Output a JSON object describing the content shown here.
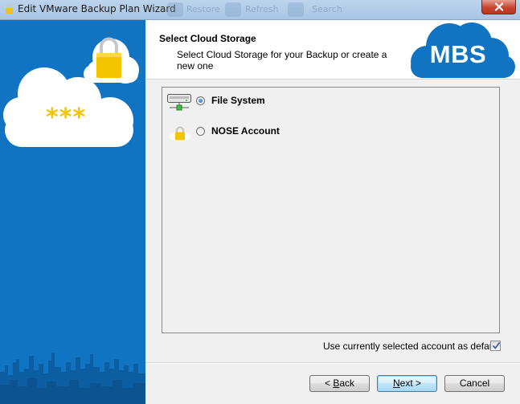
{
  "window": {
    "title": "Edit VMware Backup Plan Wizard",
    "background_toolbar": [
      "Restore",
      "Refresh",
      "Search"
    ]
  },
  "side_panel": {
    "cloud_text": "***"
  },
  "header": {
    "title": "Select Cloud Storage",
    "subtitle": "Select Cloud Storage for your Backup or create a new one",
    "logo_text": "MBS"
  },
  "storage_options": [
    {
      "label": "File System",
      "icon": "hard-drive-icon",
      "selected": true
    },
    {
      "label": "NOSE Account",
      "icon": "padlock-icon",
      "selected": false
    }
  ],
  "default_checkbox": {
    "label": "Use currently selected account as default",
    "checked": true
  },
  "buttons": {
    "back_prefix": "< ",
    "back_accel": "B",
    "back_rest": "ack",
    "next_accel": "N",
    "next_rest": "ext >",
    "cancel": "Cancel"
  },
  "colors": {
    "side_panel": "#1174c2",
    "logo_cloud": "#1174c2",
    "lock_gold": "#f5c400",
    "close_button": "#c7442f"
  }
}
